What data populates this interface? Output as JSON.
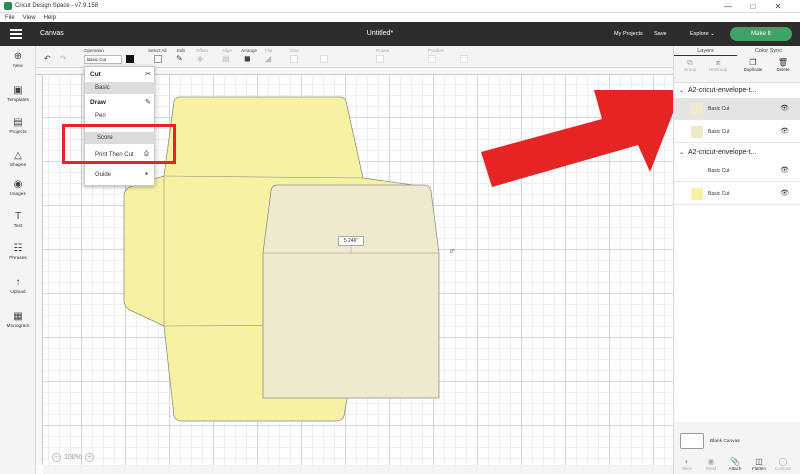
{
  "window": {
    "title": "Cricut Design Space - v7.9.158",
    "minimize": "—",
    "maximize": "□",
    "close": "✕"
  },
  "menubar": {
    "items": [
      "File",
      "View",
      "Help"
    ]
  },
  "header": {
    "canvas_label": "Canvas",
    "project_title": "Untitled*",
    "my_projects": "My Projects",
    "save": "Save",
    "explore": "Explore",
    "make_it": "Make It"
  },
  "toolbar": {
    "undo_icon": "↶",
    "redo_icon": "↷",
    "operation_label": "Operation",
    "operation_value": "Basic Cut",
    "select_all": "Select All",
    "edit": "Edit",
    "offset": "Offset",
    "align": "Align",
    "arrange": "Arrange",
    "flip": "Flip",
    "size": "Size",
    "rotate": "Rotate",
    "position": "Position"
  },
  "sidebar": {
    "items": [
      {
        "label": "New",
        "icon": "⊕"
      },
      {
        "label": "Templates",
        "icon": "▣"
      },
      {
        "label": "Projects",
        "icon": "▤"
      },
      {
        "label": "Shapes",
        "icon": "△"
      },
      {
        "label": "Images",
        "icon": "◉"
      },
      {
        "label": "Text",
        "icon": "T"
      },
      {
        "label": "Phrases",
        "icon": "☷"
      },
      {
        "label": "Upload",
        "icon": "↑"
      },
      {
        "label": "Monogram",
        "icon": "▦"
      }
    ]
  },
  "operation_menu": {
    "cut_heading": "Cut",
    "basic": "Basic",
    "draw_heading": "Draw",
    "pen": "Pen",
    "score": "Score",
    "print_then_cut": "Print Then Cut",
    "guide": "Guide"
  },
  "canvas": {
    "dimension_label": "5.246\"",
    "rotation_label": "0°",
    "zoom_level": "100%",
    "zoom_out": "−",
    "zoom_in": "+"
  },
  "layers_panel": {
    "tabs": [
      "Layers",
      "Color Sync"
    ],
    "tools": [
      "Group",
      "UnGroup",
      "Duplicate",
      "Delete"
    ],
    "groups": [
      {
        "name": "A2-cricut-envelope-t...",
        "layers": [
          {
            "name": "Basic Cut",
            "color": "#efeacd",
            "selected": true
          },
          {
            "name": "Basic Cut",
            "color": "#eeeac9",
            "selected": false
          }
        ]
      },
      {
        "name": "A2-cricut-envelope-t...",
        "layers": [
          {
            "name": "Basic Cut",
            "color": "#ffffff",
            "selected": false
          },
          {
            "name": "Basic Cut",
            "color": "#f7f2a2",
            "selected": false
          }
        ]
      }
    ],
    "blank_canvas": "Blank Canvas",
    "bottom_tools": [
      "Slice",
      "Weld",
      "Attach",
      "Flatten",
      "Contour"
    ]
  },
  "colors": {
    "accent_green": "#3fa365",
    "envelope_yellow": "#f7f2a2",
    "envelope_cream": "#efeacd",
    "highlight_red": "#e62424",
    "header_dark": "#2d2d2d"
  }
}
